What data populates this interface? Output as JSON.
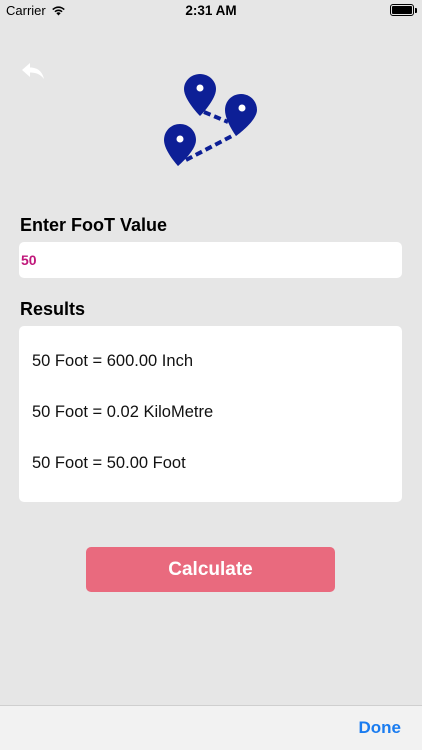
{
  "status_bar": {
    "carrier": "Carrier",
    "time": "2:31 AM",
    "icons": [
      "wifi-icon",
      "battery-icon"
    ]
  },
  "colors": {
    "background": "#e6e6e6",
    "accent_button": "#e96a7e",
    "logo_blue": "#0d1f96",
    "input_text": "#c0177a",
    "done_link": "#1a7cf0"
  },
  "header": {
    "back_icon": "back-arrow-icon",
    "logo_icon": "map-pins-route-icon"
  },
  "form": {
    "label": "Enter FooT Value",
    "value": "50"
  },
  "results": {
    "label": "Results",
    "lines": [
      "50 Foot = 600.00 Inch",
      "50 Foot = 0.02 KiloMetre",
      "50 Foot = 50.00 Foot"
    ]
  },
  "actions": {
    "calculate_label": "Calculate"
  },
  "toolbar": {
    "done_label": "Done"
  }
}
